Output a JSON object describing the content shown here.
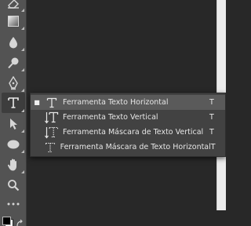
{
  "toolbar": {
    "tools": [
      {
        "name": "eraser-tool",
        "icon": "eraser-icon"
      },
      {
        "name": "gradient-tool",
        "icon": "gradient-icon"
      },
      {
        "name": "blur-tool",
        "icon": "drop-icon"
      },
      {
        "name": "dodge-tool",
        "icon": "dodge-icon"
      },
      {
        "name": "pen-tool",
        "icon": "pen-icon"
      },
      {
        "name": "type-tool",
        "icon": "type-icon",
        "active": true
      },
      {
        "name": "path-selection-tool",
        "icon": "arrow-icon"
      },
      {
        "name": "ellipse-tool",
        "icon": "ellipse-icon"
      },
      {
        "name": "hand-tool",
        "icon": "hand-icon"
      },
      {
        "name": "zoom-tool",
        "icon": "zoom-icon"
      },
      {
        "name": "more-tools",
        "icon": "ellipsis-icon"
      }
    ]
  },
  "flyout": {
    "items": [
      {
        "label": "Ferramenta Texto Horizontal",
        "shortcut": "T",
        "icon": "horizontal-type-icon",
        "selected": true
      },
      {
        "label": "Ferramenta Texto Vertical",
        "shortcut": "T",
        "icon": "vertical-type-icon",
        "selected": false
      },
      {
        "label": "Ferramenta Máscara de Texto Vertical",
        "shortcut": "T",
        "icon": "vertical-type-mask-icon",
        "selected": false
      },
      {
        "label": "Ferramenta Máscara de Texto Horizontal",
        "shortcut": "T",
        "icon": "horizontal-type-mask-icon",
        "selected": false
      }
    ]
  },
  "colors": {
    "toolbar_bg": "#535353",
    "canvas_bg": "#282828",
    "menu_bg": "#424242",
    "menu_selected": "#5a5a5a",
    "text": "#e6e6e6"
  }
}
